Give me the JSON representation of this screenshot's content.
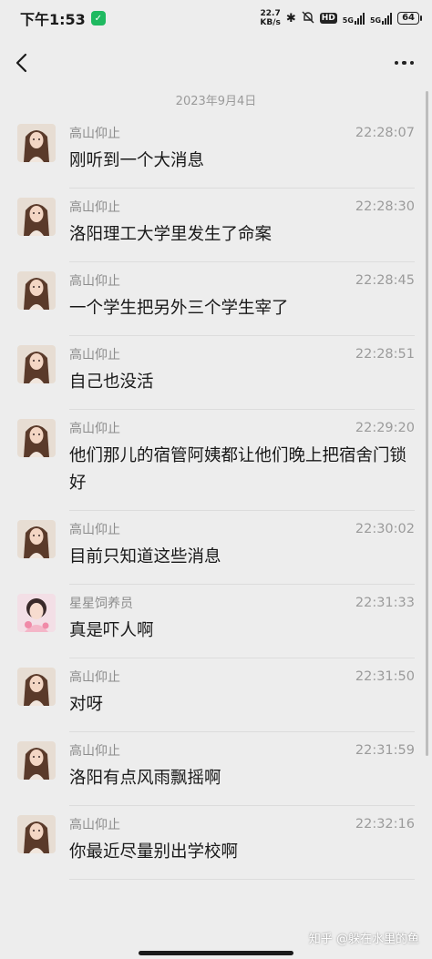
{
  "status_bar": {
    "time": "下午1:53",
    "net_speed_value": "22.7",
    "net_speed_unit": "KB/s",
    "hd_label": "HD",
    "signal_1": "5G",
    "signal_2": "5G",
    "battery": "64"
  },
  "nav": {
    "back_icon": "chevron-left-icon",
    "more_icon": "more-dots-icon"
  },
  "date_separator": "2023年9月4日",
  "messages": [
    {
      "sender": "高山仰止",
      "time": "22:28:07",
      "text": "刚听到一个大消息",
      "avatar": "girl-long-hair"
    },
    {
      "sender": "高山仰止",
      "time": "22:28:30",
      "text": "洛阳理工大学里发生了命案",
      "avatar": "girl-long-hair"
    },
    {
      "sender": "高山仰止",
      "time": "22:28:45",
      "text": "一个学生把另外三个学生宰了",
      "avatar": "girl-long-hair"
    },
    {
      "sender": "高山仰止",
      "time": "22:28:51",
      "text": "自己也没活",
      "avatar": "girl-long-hair"
    },
    {
      "sender": "高山仰止",
      "time": "22:29:20",
      "text": "他们那儿的宿管阿姨都让他们晚上把宿舍门锁好",
      "avatar": "girl-long-hair"
    },
    {
      "sender": "高山仰止",
      "time": "22:30:02",
      "text": "目前只知道这些消息",
      "avatar": "girl-long-hair"
    },
    {
      "sender": "星星饲养员",
      "time": "22:31:33",
      "text": "真是吓人啊",
      "avatar": "girl-pink"
    },
    {
      "sender": "高山仰止",
      "time": "22:31:50",
      "text": "对呀",
      "avatar": "girl-long-hair"
    },
    {
      "sender": "高山仰止",
      "time": "22:31:59",
      "text": "洛阳有点风雨飘摇啊",
      "avatar": "girl-long-hair"
    },
    {
      "sender": "高山仰止",
      "time": "22:32:16",
      "text": "你最近尽量别出学校啊",
      "avatar": "girl-long-hair"
    }
  ],
  "watermark": "知乎 @躲在水里的鱼",
  "colors": {
    "background": "#ededed",
    "shield": "#1fb960",
    "sender": "#8c8c8c",
    "text": "#191919"
  }
}
